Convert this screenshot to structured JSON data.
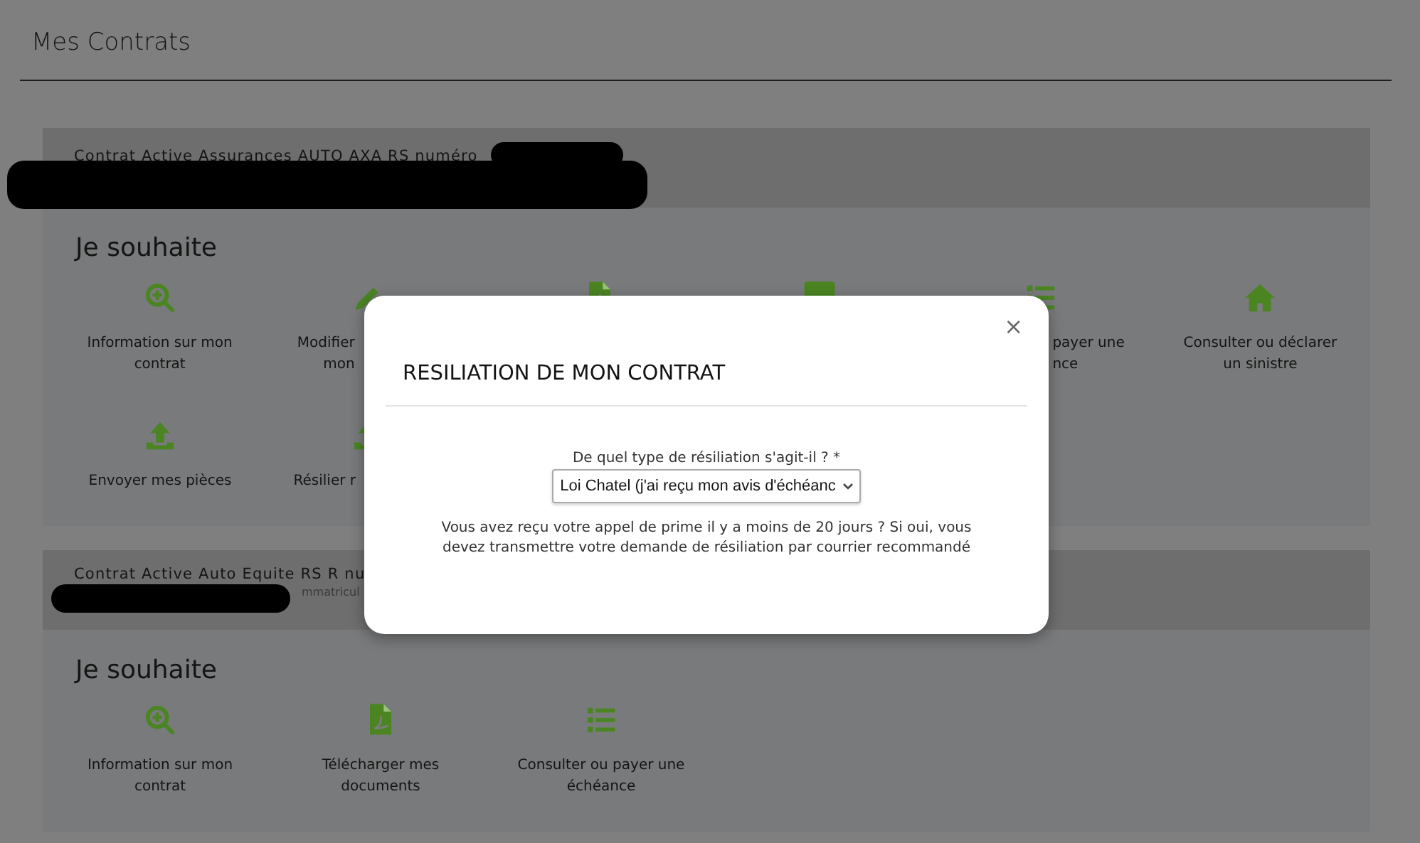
{
  "page_title": "Mes Contrats",
  "contracts": [
    {
      "header": "Contrat Active Assurances AUTO AXA RS numéro",
      "section_title": "Je souhaite",
      "rows": [
        [
          {
            "kind": "info",
            "lines": [
              "Information sur mon",
              "contrat"
            ]
          },
          {
            "kind": "edit",
            "lines": [
              "Modifier",
              "mon"
            ],
            "covered": true
          },
          {
            "kind": "documents"
          },
          {
            "kind": "card"
          },
          {
            "kind": "schedule",
            "lines": [
              "payer une",
              "nce"
            ],
            "covered": true
          },
          {
            "kind": "claim",
            "lines": [
              "Consulter ou déclarer",
              "un sinistre"
            ]
          }
        ],
        [
          {
            "kind": "upload",
            "lines": [
              "Envoyer mes pièces"
            ]
          },
          {
            "kind": "cancel",
            "lines": [
              "Résilier r"
            ],
            "covered": true
          }
        ]
      ]
    },
    {
      "header": "Contrat Active Auto Equite RS R nu",
      "subheader": "mmatricul",
      "section_title": "Je souhaite",
      "rows": [
        [
          {
            "kind": "info",
            "lines": [
              "Information sur mon",
              "contrat"
            ]
          },
          {
            "kind": "documents",
            "lines": [
              "Télécharger mes",
              "documents"
            ]
          },
          {
            "kind": "schedule",
            "lines": [
              "Consulter ou payer une",
              "échéance"
            ]
          }
        ]
      ]
    }
  ],
  "modal": {
    "title": "RESILIATION DE MON CONTRAT",
    "close": "×",
    "field_label": "De quel type de résiliation s'agit-il ? *",
    "select_value": "Loi Chatel (j'ai reçu mon avis d'échéanc",
    "info_text": "Vous avez reçu votre appel de prime il y a moins de 20 jours ? Si oui, vous devez transmettre votre demande de résiliation par courrier recommandé"
  }
}
